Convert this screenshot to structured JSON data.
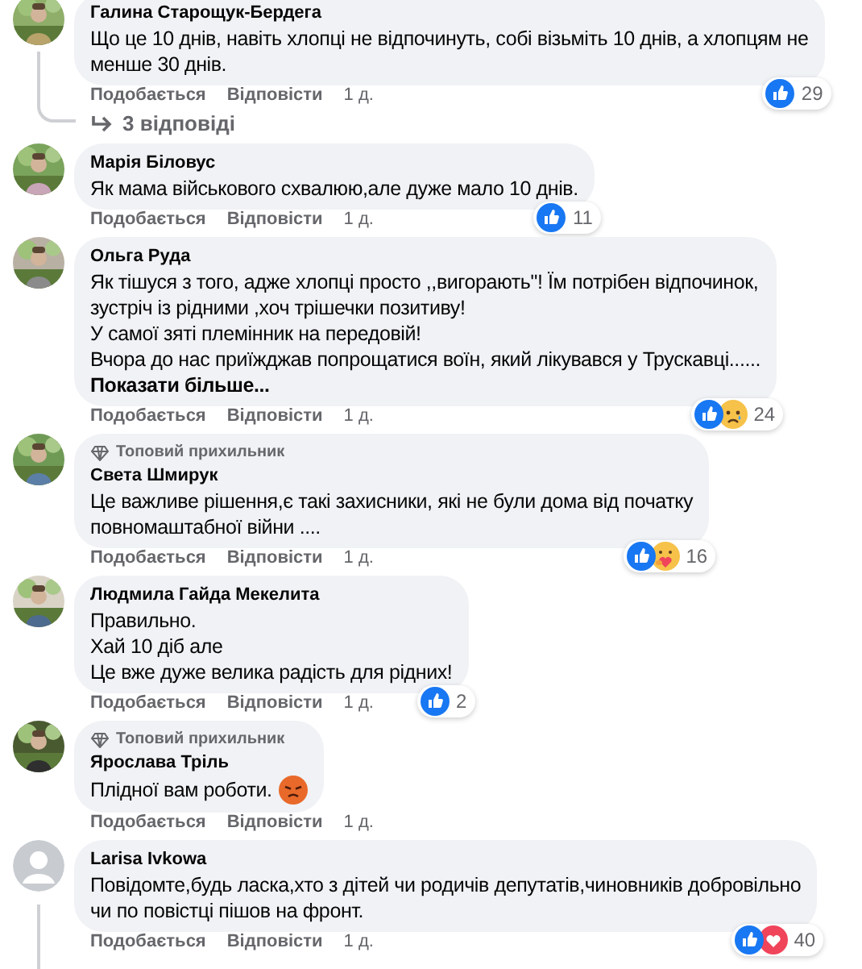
{
  "comments": [
    {
      "author": "Галина Старощук-Бердега",
      "avatar": {
        "kind": "picture"
      },
      "lines": [
        "Що це 10 днів, навіть хлопці не відпочинуть, собі візьміть 10 днів, а хлопцям не",
        "менше 30 днів."
      ],
      "reactions": [
        {
          "kind": "like"
        }
      ],
      "reaction_count": "29",
      "actions": [
        "Подобається",
        "Відповісти"
      ],
      "time": "1 д.",
      "replies": "3 відповіді"
    },
    {
      "author": "Марія Біловус",
      "avatar": {
        "kind": "picture"
      },
      "lines": [
        "Як мама військового схвалюю,але дуже мало 10 днів."
      ],
      "reactions": [
        {
          "kind": "like"
        }
      ],
      "reaction_count": "11",
      "actions": [
        "Подобається",
        "Відповісти"
      ],
      "time": "1 д."
    },
    {
      "author": "Ольга Руда",
      "avatar": {
        "kind": "picture"
      },
      "lines": [
        "Як тішуся з того, адже хлопці просто ,,вигорають\"! Їм потрібен відпочинок,",
        "зустріч із рідними ,хоч трішечки позитиву!",
        "У самої зяті племінник на передовій!",
        "Вчора до нас приїжджав попрощатися воїн, який лікувався у Трускавці......"
      ],
      "show_more": "Показати більше...",
      "reactions": [
        {
          "kind": "like"
        },
        {
          "kind": "sad"
        }
      ],
      "reaction_count": "24",
      "actions": [
        "Подобається",
        "Відповісти"
      ],
      "time": "1 д."
    },
    {
      "badge": "Топовий прихильник",
      "author": "Света Шмирук",
      "avatar": {
        "kind": "picture"
      },
      "lines": [
        "Це важливе рішення,є такі захисники, які не були дома від початку",
        "повномаштабної війни ...."
      ],
      "reactions": [
        {
          "kind": "like"
        },
        {
          "kind": "care"
        }
      ],
      "reaction_count": "16",
      "actions": [
        "Подобається",
        "Відповісти"
      ],
      "time": "1 д."
    },
    {
      "author": "Людмила Гайда Мекелита",
      "avatar": {
        "kind": "picture"
      },
      "lines": [
        "Правильно.",
        "Хай 10 діб але",
        "Це вже дуже велика радість для рідних!"
      ],
      "reactions": [
        {
          "kind": "like"
        }
      ],
      "reaction_count": "2",
      "actions": [
        "Подобається",
        "Відповісти"
      ],
      "time": "1 д."
    },
    {
      "badge": "Топовий прихильник",
      "author": "Ярослава Тріль",
      "avatar": {
        "kind": "picture"
      },
      "lines": [
        "Плідної вам роботи."
      ],
      "emoji": {
        "kind": "angry"
      },
      "actions": [
        "Подобається",
        "Відповісти"
      ],
      "time": "1 д."
    },
    {
      "author": "Larisa Ivkowa",
      "avatar": {
        "kind": "default"
      },
      "lines": [
        "Повідомте,будь ласка,хто з дітей чи родичів депутатів,чиновників добровільно",
        "чи по повістці пішов на фронт."
      ],
      "reactions": [
        {
          "kind": "like"
        },
        {
          "kind": "love"
        }
      ],
      "reaction_count": "40",
      "actions": [
        "Подобається",
        "Відповісти"
      ],
      "time": "1 д.",
      "thread": true
    }
  ]
}
